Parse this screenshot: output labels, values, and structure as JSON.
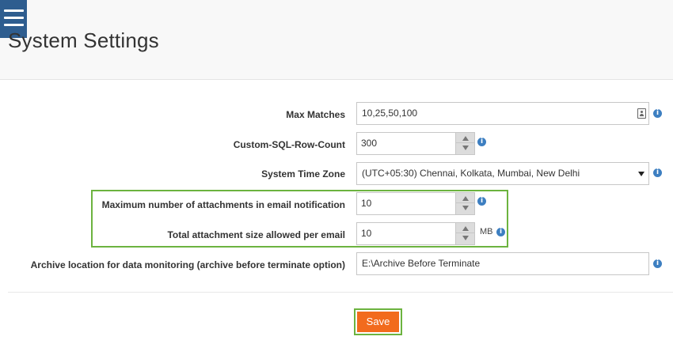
{
  "header": {
    "title": "System Settings",
    "menu_icon": "hamburger-menu-icon"
  },
  "settings": {
    "max_matches": {
      "label": "Max Matches",
      "value": "10,25,50,100",
      "icon": "contact-card-icon"
    },
    "custom_sql_row_count": {
      "label": "Custom-SQL-Row-Count",
      "value": "300"
    },
    "system_time_zone": {
      "label": "System Time Zone",
      "value": "(UTC+05:30) Chennai, Kolkata, Mumbai, New Delhi"
    },
    "max_attachments": {
      "label": "Maximum number of attachments in email notification",
      "value": "10"
    },
    "total_attachment_size": {
      "label": "Total attachment size allowed per email",
      "value": "10",
      "unit": "MB"
    },
    "archive_location": {
      "label": "Archive location for data monitoring (archive before terminate option)",
      "value": "E:\\Archive Before Terminate"
    }
  },
  "info_glyph": "i",
  "actions": {
    "save_label": "Save"
  },
  "colors": {
    "menu_background": "#2e5d8f",
    "info_icon": "#3d7fc1",
    "highlight_border": "#6cb33f",
    "save_button": "#f26b1d"
  }
}
